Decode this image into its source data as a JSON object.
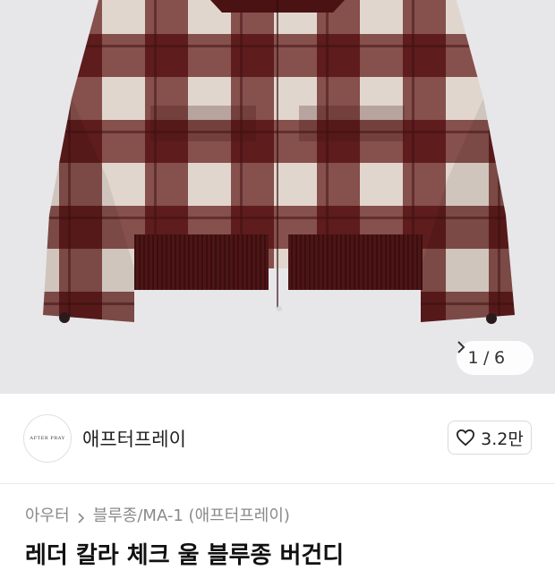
{
  "product": {
    "image_alt_icon": "plaid-jacket-photo",
    "pager": {
      "current": "1",
      "separator": "/",
      "total": "6"
    },
    "title": "레더 칼라 체크 울 블루종 버건디"
  },
  "store": {
    "logo_text": "AFTER PRAY",
    "name": "애프터프레이",
    "likes": "3.2만"
  },
  "breadcrumb": {
    "items": [
      "아우터",
      "블루종/MA-1 (애프터프레이)"
    ]
  },
  "colors": {
    "burgundy": "#5a1a1b",
    "cream": "#e2d7cf",
    "mid": "#9f6f69",
    "background": "#e7e7ea"
  }
}
